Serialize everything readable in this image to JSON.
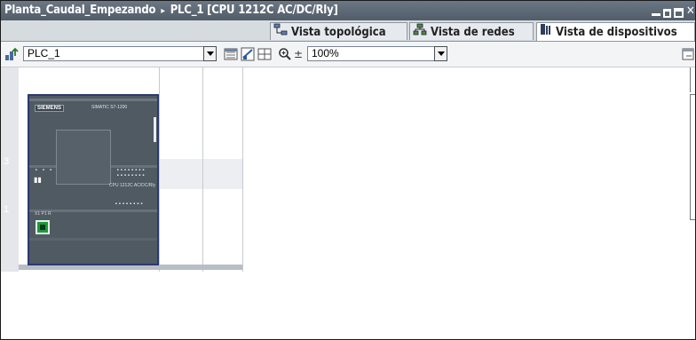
{
  "window": {
    "project": "Planta_Caudal_Empezando",
    "breadcrumb_sep": "▸",
    "device": "PLC_1 [CPU 1212C AC/DC/Rly]"
  },
  "tabs": [
    {
      "label": "Vista topológica",
      "icon": "topology-icon",
      "active": false
    },
    {
      "label": "Vista de redes",
      "icon": "network-icon",
      "active": false
    },
    {
      "label": "Vista de dispositivos",
      "icon": "device-icon",
      "active": true
    }
  ],
  "toolbar": {
    "device_select": "PLC_1",
    "zoom": "100%"
  },
  "rack": {
    "slot_labels": [
      "3",
      "1"
    ]
  },
  "plc": {
    "brand": "SIEMENS",
    "model_top": "SIMATIC S7-1200",
    "model_side": "CPU 1212C AC/DC/Rly",
    "port_label": "X1 P1 R"
  },
  "colors": {
    "titlebar": "#5e6975",
    "plc_body": "#4f5a63",
    "selection": "#2a3a6e",
    "profinet_port": "#1d9a3a"
  }
}
